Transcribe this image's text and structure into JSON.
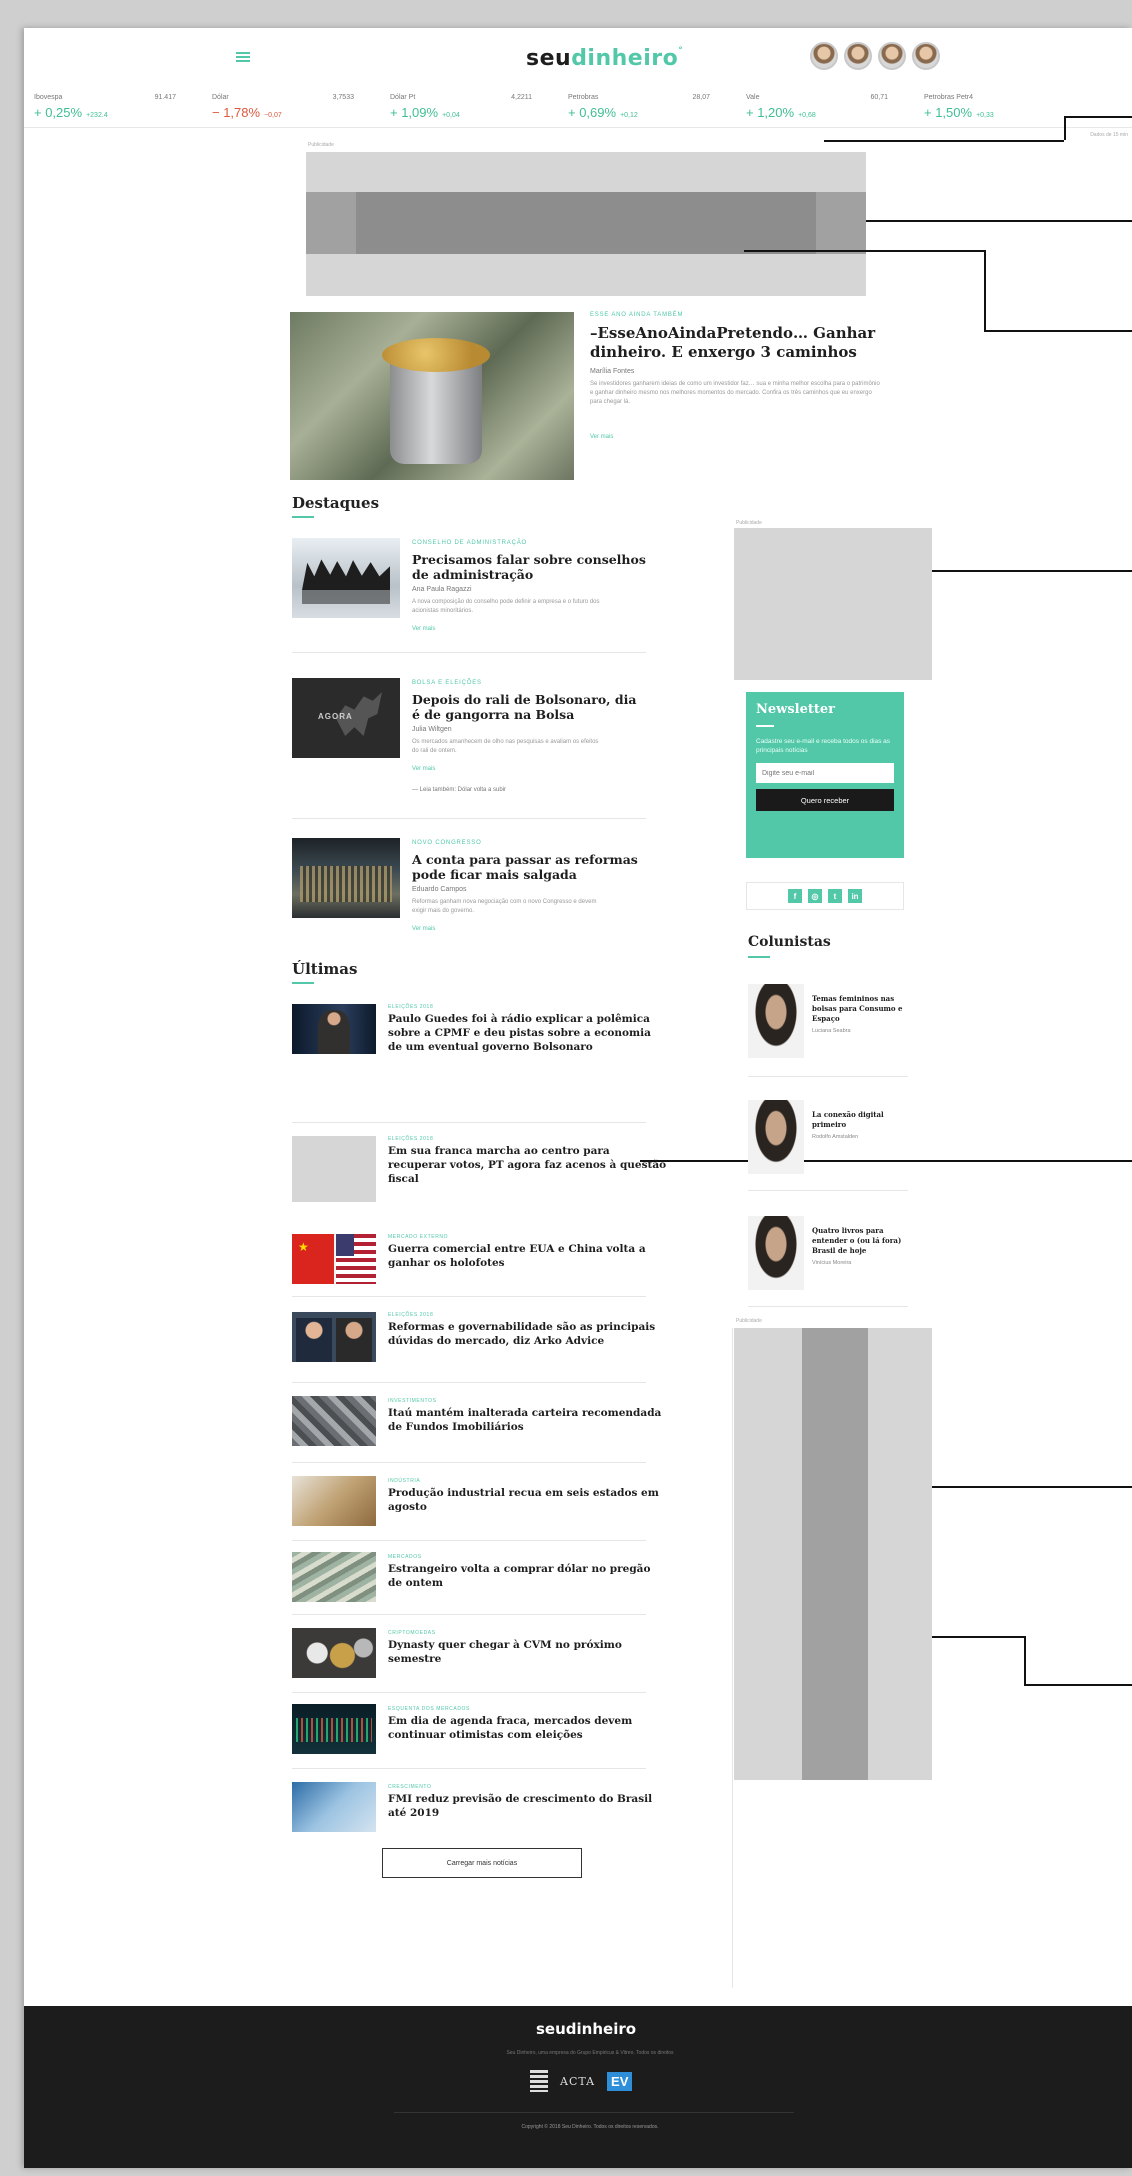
{
  "header": {
    "logo_part1": "seu",
    "logo_part2": "dinheiro",
    "avatars": [
      "avatar-1",
      "avatar-2",
      "avatar-3",
      "avatar-4"
    ]
  },
  "ticker": [
    {
      "name": "Ibovespa",
      "value": "91.417",
      "change": "+ 0,25%",
      "extra": "+232.4"
    },
    {
      "name": "Dólar",
      "value": "3,7533",
      "change": "− 1,78%",
      "extra": "−0,07"
    },
    {
      "name": "Dólar Pt",
      "value": "4,2211",
      "change": "+ 1,09%",
      "extra": "+0,04"
    },
    {
      "name": "Petrobras",
      "value": "28,07",
      "change": "+ 0,69%",
      "extra": "+0,12"
    },
    {
      "name": "Vale",
      "value": "60,71",
      "change": "+ 1,20%",
      "extra": "+0,68"
    },
    {
      "name": "Petrobras Petr4",
      "value": "",
      "change": "+ 1,50%",
      "extra": "+0,33"
    }
  ],
  "ticker_note": "Dados de 15 min",
  "ads": {
    "label": "Publicidade"
  },
  "hero": {
    "kicker": "ESSE ANO AINDA TAMBÉM",
    "title": "–EsseAnoAindaPretendo… Ganhar dinheiro. E enxergo 3 caminhos",
    "author": "Marília Fontes",
    "excerpt": "Se investidores ganharem ideias de como um investidor faz… sua e minha melhor escolha para o patrimônio e ganhar dinheiro mesmo nos melhores momentos do mercado. Confira os três caminhos que eu enxergo para chegar lá.",
    "more": "Ver mais"
  },
  "destaques": {
    "title": "Destaques",
    "items": [
      {
        "kicker": "CONSELHO DE ADMINISTRAÇÃO",
        "title": "Precisamos falar sobre conselhos de administração",
        "author": "Ana Paula Ragazzi",
        "excerpt": "A nova composição do conselho pode definir a empresa e o futuro dos acionistas minoritários.",
        "more": "Ver mais"
      },
      {
        "kicker": "BOLSA E ELEIÇÕES",
        "title": "Depois do rali de Bolsonaro, dia é de gangorra na Bolsa",
        "author": "Julia Wiltgen",
        "excerpt": "Os mercados amanhecem de olho nas pesquisas e avaliam os efeitos do rali de ontem.",
        "more": "Ver mais",
        "related": "— Leia também: Dólar volta a subir"
      },
      {
        "kicker": "NOVO CONGRESSO",
        "title": "A conta para passar as reformas pode ficar mais salgada",
        "author": "Eduardo Campos",
        "excerpt": "Reformas ganham nova negociação com o novo Congresso e devem exigir mais do governo.",
        "more": "Ver mais"
      }
    ]
  },
  "ultimas": {
    "title": "Últimas",
    "items": [
      {
        "kicker": "ELEIÇÕES 2018",
        "title": "Paulo Guedes foi à rádio explicar a polêmica sobre a CPMF e deu pistas sobre a economia de um eventual governo Bolsonaro"
      },
      {
        "kicker": "ELEIÇÕES 2018",
        "title": "Em sua franca marcha ao centro para recuperar votos, PT agora faz acenos à questão fiscal"
      },
      {
        "kicker": "MERCADO EXTERNO",
        "title": "Guerra comercial entre EUA e China volta a ganhar os holofotes"
      },
      {
        "kicker": "ELEIÇÕES 2018",
        "title": "Reformas e governabilidade são as principais dúvidas do mercado, diz Arko Advice"
      },
      {
        "kicker": "INVESTIMENTOS",
        "title": "Itaú mantém inalterada carteira recomendada de Fundos Imobiliários"
      },
      {
        "kicker": "INDÚSTRIA",
        "title": "Produção industrial recua em seis estados em agosto"
      },
      {
        "kicker": "MERCADOS",
        "title": "Estrangeiro volta a comprar dólar no pregão de ontem"
      },
      {
        "kicker": "CRIPTOMOEDAS",
        "title": "Dynasty quer chegar à CVM no próximo semestre"
      },
      {
        "kicker": "ESQUENTA DOS MERCADOS",
        "title": "Em dia de agenda fraca, mercados devem continuar otimistas com eleições"
      },
      {
        "kicker": "CRESCIMENTO",
        "title": "FMI reduz previsão de crescimento do Brasil até 2019"
      }
    ],
    "load_more": "Carregar mais notícias"
  },
  "newsletter": {
    "title": "Newsletter",
    "desc": "Cadastre seu e-mail e receba todos os dias as principais notícias",
    "placeholder": "Digite seu e-mail",
    "button": "Quero receber"
  },
  "social": [
    "f",
    "◎",
    "t",
    "in"
  ],
  "colunistas": {
    "title": "Colunistas",
    "items": [
      {
        "title": "Temas femininos nas bolsas para Consumo e Espaço",
        "author": "Luciana Seabra"
      },
      {
        "title": "La conexão digital primeiro",
        "author": "Rodolfo Amstalden"
      },
      {
        "title": "Quatro livros para entender o (ou lá fora) Brasil de hoje",
        "author": "Vinícius Moreira"
      }
    ]
  },
  "footer": {
    "logo": "seudinheiro",
    "sub": "Seu Dinheiro, uma empresa do Grupo Empiricus & Vitreo. Todos os direitos",
    "brand1": "ACTA",
    "brand2": "EV",
    "copy": "Copyright © 2018 Seu Dinheiro. Todos os direitos reservados."
  },
  "colors": {
    "accent": "#52c8a8",
    "footer": "#1c1c1c"
  }
}
